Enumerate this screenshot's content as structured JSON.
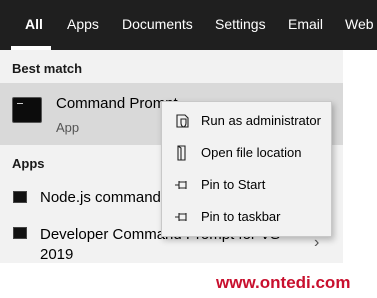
{
  "tabs": [
    {
      "label": "All",
      "active": true
    },
    {
      "label": "Apps"
    },
    {
      "label": "Documents"
    },
    {
      "label": "Settings"
    },
    {
      "label": "Email"
    },
    {
      "label": "Web"
    }
  ],
  "best_match": {
    "heading": "Best match",
    "title": "Command Prompt",
    "subtitle": "App"
  },
  "apps": {
    "heading": "Apps",
    "items": [
      {
        "label": "Node.js command prompt"
      },
      {
        "label": "Developer Command Prompt for VS",
        "label_line2": "2019"
      }
    ]
  },
  "context_menu": [
    {
      "label": "Run as administrator",
      "icon": "shield-icon"
    },
    {
      "label": "Open file location",
      "icon": "file-location-icon"
    },
    {
      "label": "Pin to Start",
      "icon": "pin-icon"
    },
    {
      "label": "Pin to taskbar",
      "icon": "pin-icon"
    }
  ],
  "watermark": "www.ontedi.com",
  "colors": {
    "tabbar": "#1f1f1f",
    "panel": "#f2f2f2",
    "selected": "#d9d9d9",
    "watermark": "#c8102e"
  }
}
